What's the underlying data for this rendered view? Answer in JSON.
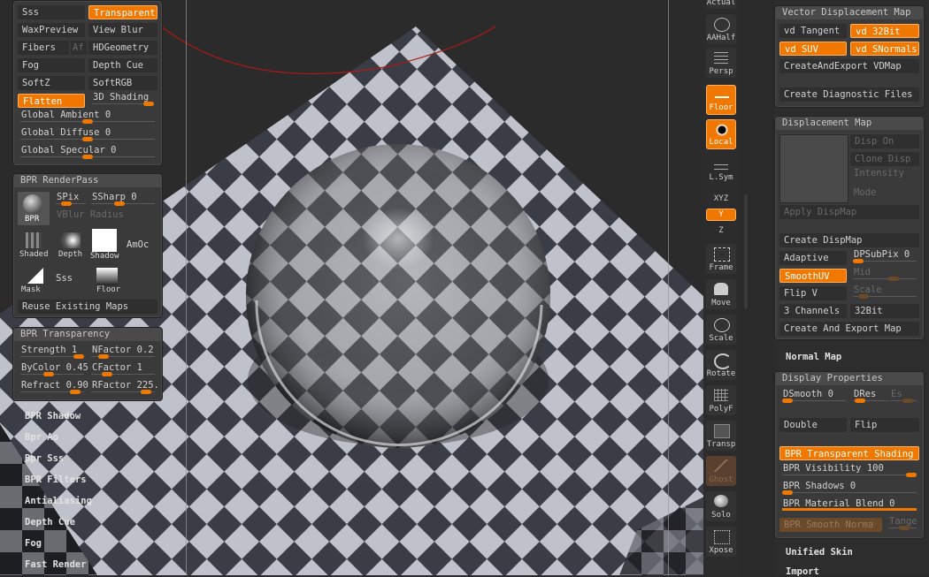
{
  "render_panel": {
    "rows": [
      {
        "left": "Sss",
        "right": "Transparent",
        "right_on": true
      },
      {
        "left": "WaxPreview",
        "right": "View Blur"
      },
      {
        "left": "Fibers",
        "mid": "Af",
        "right": "HDGeometry"
      },
      {
        "left": "Fog",
        "right": "Depth Cue"
      },
      {
        "left": "SoftZ",
        "right": "SoftRGB"
      },
      {
        "left": "Flatten",
        "left_on": true,
        "right": "3D Shading"
      }
    ],
    "sliders": [
      {
        "label": "Global Ambient",
        "value": "0"
      },
      {
        "label": "Global Diffuse",
        "value": "0"
      },
      {
        "label": "Global Specular",
        "value": "0"
      }
    ]
  },
  "bpr_renderpass": {
    "title": "BPR RenderPass",
    "spix_label": "SPix",
    "ssharp_label": "SSharp",
    "ssharp_value": "0",
    "vblur_label": "VBlur Radius",
    "bpr_label": "BPR",
    "thumbs": [
      "Shaded",
      "Depth",
      "Shadow",
      "AmOc"
    ],
    "thumbs2": [
      "Mask",
      "Sss",
      "Floor"
    ],
    "reuse": "Reuse Existing Maps"
  },
  "bpr_transparency": {
    "title": "BPR Transparency",
    "strength_label": "Strength",
    "strength_value": "1",
    "nfactor_label": "NFactor",
    "nfactor_value": "0.2",
    "bycolor_label": "ByColor",
    "bycolor_value": "0.45",
    "cfactor_label": "CFactor",
    "cfactor_value": "1",
    "refract_label": "Refract",
    "refract_value": "0.90",
    "rfactor_label": "RFactor",
    "rfactor_value": "225."
  },
  "left_menu": [
    "BPR Shadow",
    "Bpr Ao",
    "Bpr Sss",
    "BPR Filters",
    "Antialiasing",
    "Depth Cue",
    "Fog",
    "Fast Render"
  ],
  "toolbar": {
    "actual": "Actual",
    "buttons": [
      "AAHalf",
      "Persp",
      "Floor",
      "Local",
      "L.Sym",
      "Frame",
      "Move",
      "Scale",
      "Rotate",
      "PolyF",
      "Transp",
      "Ghost",
      "Solo",
      "Xpose"
    ],
    "xyz": "XYZ",
    "y": "Y",
    "z": "Z"
  },
  "vector_disp": {
    "title": "Vector Displacement Map",
    "vd_tangent": "vd Tangent",
    "vd_32bit": "vd 32Bit",
    "vd_suv": "vd SUV",
    "vd_snormals": "vd SNormals",
    "create_export": "CreateAndExport VDMap",
    "diagnostic": "Create Diagnostic Files"
  },
  "disp_map": {
    "title": "Displacement Map",
    "disp_on": "Disp On",
    "clone_disp": "Clone Disp",
    "intensity": "Intensity",
    "mode": "Mode",
    "apply": "Apply DispMap",
    "create": "Create DispMap",
    "adaptive": "Adaptive",
    "dpsubpix_label": "DPSubPix",
    "dpsubpix_value": "0",
    "smoothuv": "SmoothUV",
    "mid": "Mid",
    "flipv": "Flip V",
    "scale": "Scale",
    "channels": "3 Channels",
    "bit32": "32Bit",
    "create_export": "Create And Export Map"
  },
  "normal_map": "Normal Map",
  "display_props": {
    "title": "Display Properties",
    "dsmooth_label": "DSmooth",
    "dsmooth_value": "0",
    "dres": "DRes",
    "es": "Es",
    "double": "Double",
    "flip": "Flip",
    "bpr_transparent": "BPR Transparent Shading",
    "bpr_visibility_label": "BPR Visibility",
    "bpr_visibility_value": "100",
    "bpr_shadows_label": "BPR Shadows",
    "bpr_shadows_value": "0",
    "bpr_material_label": "BPR Material Blend",
    "bpr_material_value": "0",
    "bpr_smooth": "BPR Smooth Norma",
    "tange": "Tange"
  },
  "unified_skin": "Unified Skin",
  "import": "Import",
  "colors": {
    "accent": "#f07800",
    "panel": "#3a3a3a",
    "floor_light": "#b9bcc6",
    "floor_dark": "#3a3d44"
  }
}
